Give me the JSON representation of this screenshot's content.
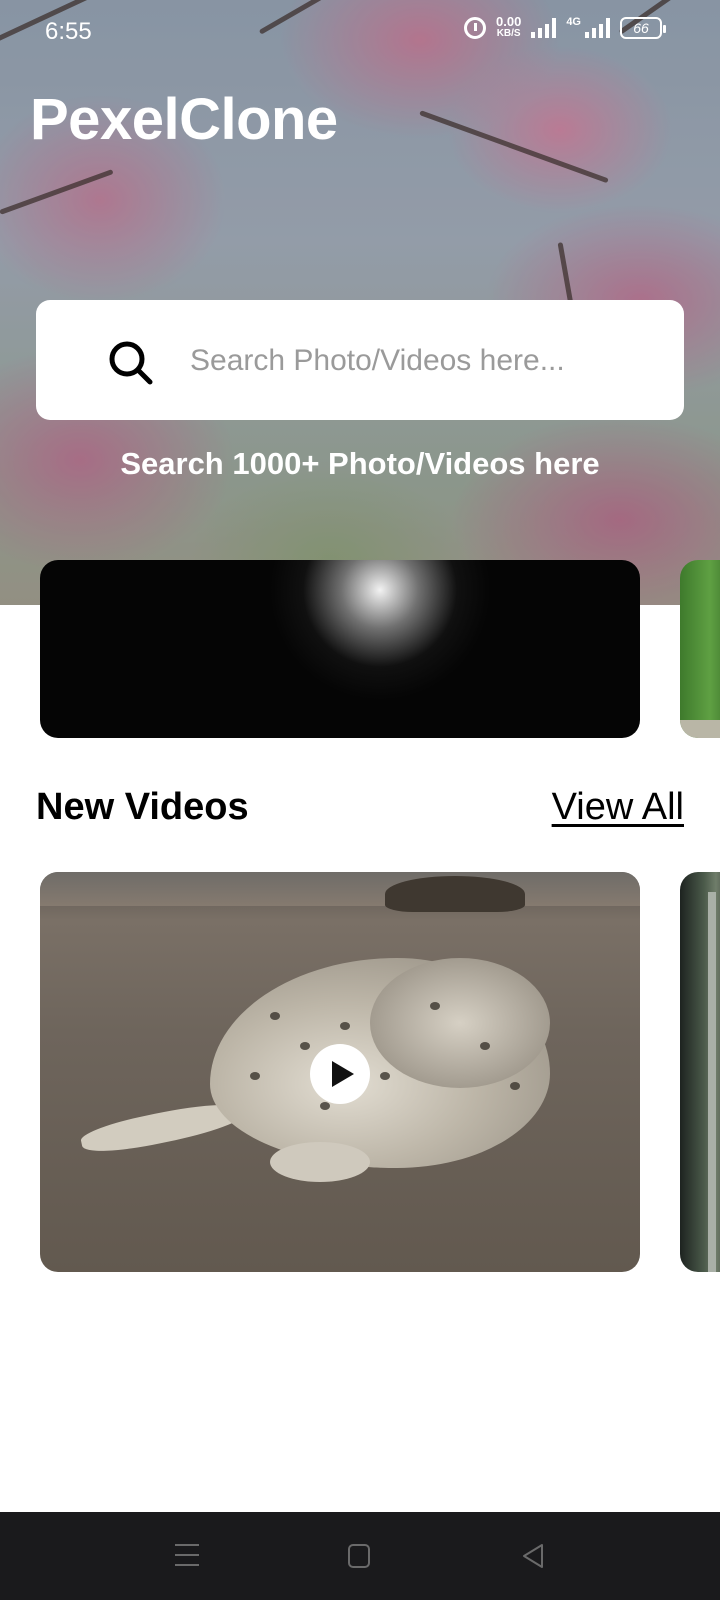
{
  "status_bar": {
    "time": "6:55",
    "net_speed_value": "0.00",
    "net_speed_unit": "KB/S",
    "network_type": "4G",
    "battery": "66"
  },
  "hero": {
    "app_title": "PexelClone",
    "search": {
      "placeholder": "Search Photo/Videos here...",
      "value": ""
    },
    "subtitle": "Search 1000+ Photo/Videos here"
  },
  "new_videos": {
    "title": "New Videos",
    "view_all_label": "View All"
  },
  "icons": {
    "search": "search-icon",
    "play": "play-icon",
    "alarm": "alarm-icon",
    "nav_menu": "menu-icon",
    "nav_home": "home-square-icon",
    "nav_back": "back-triangle-icon"
  },
  "colors": {
    "nav_bar": "#1a1a1c",
    "background": "#ffffff",
    "text_primary": "#000000"
  }
}
